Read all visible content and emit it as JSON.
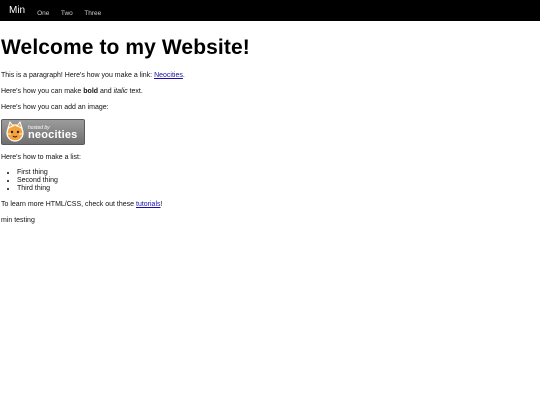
{
  "navbar": {
    "brand": "Min",
    "links": [
      "One",
      "Two",
      "Three"
    ]
  },
  "page": {
    "title": "Welcome to my Website!",
    "para1_before": "This is a paragraph! Here's how you make a link: ",
    "para1_link": "Neocities",
    "para1_after": ".",
    "para2_before": "Here's how you can make ",
    "para2_bold": "bold",
    "para2_mid": " and ",
    "para2_italic": "italic",
    "para2_after": " text.",
    "para3": "Here's how you can add an image:",
    "badge": {
      "small": "hosted by",
      "big": "neocities"
    },
    "para4": "Here's how to make a list:",
    "list_items": [
      "First thing",
      "Second thing",
      "Third thing"
    ],
    "para5_before": "To learn more HTML/CSS, check out these ",
    "para5_link": "tutorials",
    "para5_after": "!",
    "para6": "min testing"
  }
}
